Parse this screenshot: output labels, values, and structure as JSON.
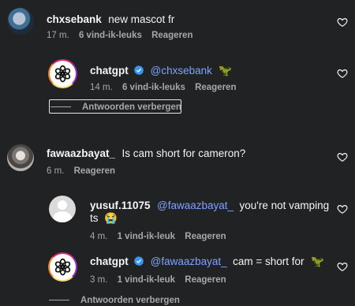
{
  "comments": [
    {
      "username": "chxsebank",
      "text": "new mascot fr",
      "time": "17 m.",
      "likes": "6 vind-ik-leuks",
      "reply": "Reageren"
    },
    {
      "username": "chatgpt",
      "mention": "@chxsebank",
      "emoji": "🦖",
      "time": "14 m.",
      "likes": "6 vind-ik-leuks",
      "reply": "Reageren",
      "hide_replies": "Antwoorden verbergen"
    },
    {
      "username": "fawaazbayat_",
      "text": "Is cam short for cameron?",
      "time": "6 m.",
      "reply": "Reageren"
    },
    {
      "username": "yusuf.11075",
      "mention": "@fawaazbayat_",
      "text": "you're not vamping",
      "text2": "ts",
      "emoji": "😭",
      "time": "4 m.",
      "likes": "1 vind-ik-leuk",
      "reply": "Reageren"
    },
    {
      "username": "chatgpt",
      "mention": "@fawaazbayat_",
      "text": "cam = short for",
      "emoji": "🦖",
      "time": "3 m.",
      "likes": "1 vind-ik-leuk",
      "reply": "Reageren"
    }
  ],
  "thread_footer": {
    "hide_replies": "Antwoorden verbergen"
  },
  "icons": {
    "like": "heart-icon",
    "verified": "verified-badge-icon",
    "chatgpt_logo": "openai-logo-icon"
  },
  "colors": {
    "background": "#212224",
    "mention": "#7ea2ff",
    "verified": "#3897f0",
    "muted": "#a8a8a8"
  }
}
